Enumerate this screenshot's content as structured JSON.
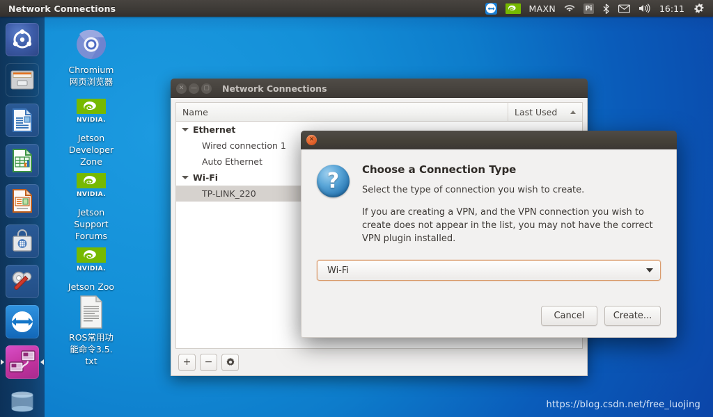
{
  "panel": {
    "title": "Network Connections",
    "tray": [
      {
        "name": "teamviewer-icon",
        "label": ""
      },
      {
        "name": "nvidia-icon",
        "label": ""
      },
      {
        "name": "power-mode-indicator",
        "label": "MAXN"
      },
      {
        "name": "wifi-icon",
        "label": ""
      },
      {
        "name": "pi-indicator-icon",
        "label": "Pi"
      },
      {
        "name": "bluetooth-icon",
        "label": ""
      },
      {
        "name": "mail-icon",
        "label": ""
      },
      {
        "name": "volume-icon",
        "label": ""
      }
    ],
    "clock": "16:11",
    "session_icon": "power-gear-icon"
  },
  "launcher": {
    "items": [
      {
        "name": "ubuntu-dash",
        "icon": "ubuntu-logo-icon",
        "running": false,
        "focused": false
      },
      {
        "name": "files",
        "icon": "file-manager-icon",
        "running": false,
        "focused": false
      },
      {
        "name": "libreoffice-writer",
        "icon": "writer-icon",
        "running": false,
        "focused": false
      },
      {
        "name": "libreoffice-calc",
        "icon": "calc-icon",
        "running": false,
        "focused": false
      },
      {
        "name": "libreoffice-impress",
        "icon": "impress-icon",
        "running": false,
        "focused": false
      },
      {
        "name": "software-center",
        "icon": "software-center-icon",
        "running": false,
        "focused": false
      },
      {
        "name": "system-settings",
        "icon": "gear-wrench-icon",
        "running": false,
        "focused": false
      },
      {
        "name": "teamviewer",
        "icon": "teamviewer-icon",
        "running": false,
        "focused": false
      },
      {
        "name": "network-connections",
        "icon": "network-connections-icon",
        "running": true,
        "focused": true
      },
      {
        "name": "trash",
        "icon": "trash-icon",
        "running": false,
        "focused": false
      }
    ]
  },
  "desktop": {
    "icons": [
      {
        "name": "chromium",
        "icon": "chromium-icon",
        "lines": [
          "Chromium",
          "网页浏览器"
        ]
      },
      {
        "name": "jetson-developer-zone",
        "icon": "nvidia-icon",
        "lines": [
          "Jetson",
          "Developer",
          "Zone"
        ]
      },
      {
        "name": "jetson-support-forums",
        "icon": "nvidia-icon",
        "lines": [
          "Jetson",
          "Support",
          "Forums"
        ]
      },
      {
        "name": "jetson-zoo",
        "icon": "nvidia-icon",
        "lines": [
          "Jetson Zoo"
        ]
      },
      {
        "name": "ros-commands-txt",
        "icon": "text-file-icon",
        "lines": [
          "ROS常用功",
          "能命令3.5.",
          "txt"
        ]
      }
    ]
  },
  "network_window": {
    "title": "Network Connections",
    "columns": {
      "name": "Name",
      "last_used": "Last Used"
    },
    "sort": "ascending",
    "rows": [
      {
        "label": "Ethernet",
        "type": "group",
        "expanded": true,
        "selected": false
      },
      {
        "label": "Wired connection 1",
        "type": "child",
        "selected": false
      },
      {
        "label": "Auto Ethernet",
        "type": "child",
        "selected": false
      },
      {
        "label": "Wi-Fi",
        "type": "group",
        "expanded": true,
        "selected": false
      },
      {
        "label": "TP-LINK_220",
        "type": "child",
        "selected": true
      }
    ],
    "toolbar": {
      "add": "+",
      "remove": "−",
      "edit": "gear-icon"
    }
  },
  "dialog": {
    "heading": "Choose a Connection Type",
    "subtitle": "Select the type of connection you wish to create.",
    "note": "If you are creating a VPN, and the VPN connection you wish to create does not appear in the list, you may not have the correct VPN plugin installed.",
    "combo_value": "Wi-Fi",
    "buttons": {
      "cancel": "Cancel",
      "create": "Create..."
    },
    "icon": "question-mark-icon"
  },
  "watermark": "https://blog.csdn.net/free_luojing",
  "colors": {
    "panel_bg": "#3d3a36",
    "desktop_blue": "#0f8fd8",
    "accent_orange": "#e05f28",
    "nvidia_green": "#76b900",
    "selection_gray": "#d6d2ce"
  }
}
